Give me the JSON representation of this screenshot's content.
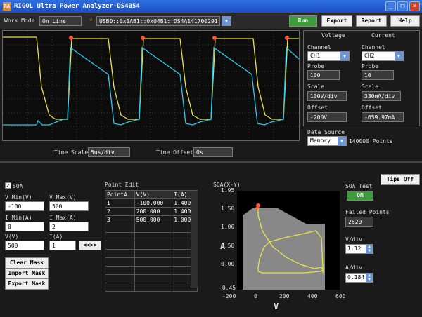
{
  "window": {
    "title": "RIGOL Ultra Power Analyzer-DS4054",
    "logo": "RA"
  },
  "toolbar": {
    "work_mode_label": "Work Mode",
    "work_mode_value": "On Line",
    "device": "USB0::0x1AB1::0x04B1::DS4A141700291::INSTR",
    "run_label": "Run",
    "export_label": "Export",
    "report_label": "Report",
    "help_label": "Help"
  },
  "voltage": {
    "heading": "Voltage",
    "channel_label": "Channel",
    "channel_value": "CH1",
    "probe_label": "Probe",
    "probe_value": "100",
    "scale_label": "Scale",
    "scale_value": "100V/div",
    "offset_label": "Offset",
    "offset_value": "-200V"
  },
  "current": {
    "heading": "Current",
    "channel_label": "Channel",
    "channel_value": "CH2",
    "probe_label": "Probe",
    "probe_value": "10",
    "scale_label": "Scale",
    "scale_value": "330mA/div",
    "offset_label": "Offset",
    "offset_value": "-659.97mA"
  },
  "data_source": {
    "label": "Data Source",
    "value": "Memory",
    "points": "140000 Points"
  },
  "timebase": {
    "scale_label": "Time Scale",
    "scale_value": "5us/div",
    "offset_label": "Time Offset",
    "offset_value": "0s"
  },
  "tips_label": "Tips Off",
  "soa_panel": {
    "enable_label": "SOA",
    "vmin_label": "V Min(V)",
    "vmin_value": "-100",
    "vmax_label": "V Max(V)",
    "vmax_value": "500",
    "imin_label": "I Min(A)",
    "imin_value": "0",
    "imax_label": "I Max(A)",
    "imax_value": "2",
    "v_label": "V(V)",
    "v_value": "500",
    "i_label": "I(A)",
    "i_value": "1",
    "add_label": "<<>>",
    "clear_label": "Clear Mask",
    "import_label": "Import Mask",
    "export_label": "Export Mask"
  },
  "point_edit": {
    "title": "Point Edit",
    "headers": [
      "Point#",
      "V(V)",
      "I(A)"
    ],
    "rows": [
      [
        "1",
        "-100.000",
        "1.400"
      ],
      [
        "2",
        "200.000",
        "1.400"
      ],
      [
        "3",
        "500.000",
        "1.000"
      ]
    ]
  },
  "soa_plot": {
    "title": "SOA(X-Y)",
    "y_ticks": [
      "1.95",
      "1.50",
      "1.00",
      "0.50",
      "0.00",
      "-0.45"
    ],
    "x_ticks": [
      "-200",
      "0",
      "200",
      "400",
      "600"
    ],
    "xlabel": "V",
    "ylabel": "A",
    "mask_color": "#888888",
    "trace_color": "#e8e24a"
  },
  "soa_test": {
    "label": "SOA Test",
    "button": "ON",
    "failed_label": "Failed Points",
    "failed_value": "2620",
    "vdiv_label": "V/div",
    "vdiv_value": "1.12",
    "adiv_label": "A/div",
    "adiv_value": "0.184"
  },
  "colors": {
    "ch1": "#e8e24a",
    "ch2": "#2fc8e6",
    "marker": "#ff5533"
  }
}
